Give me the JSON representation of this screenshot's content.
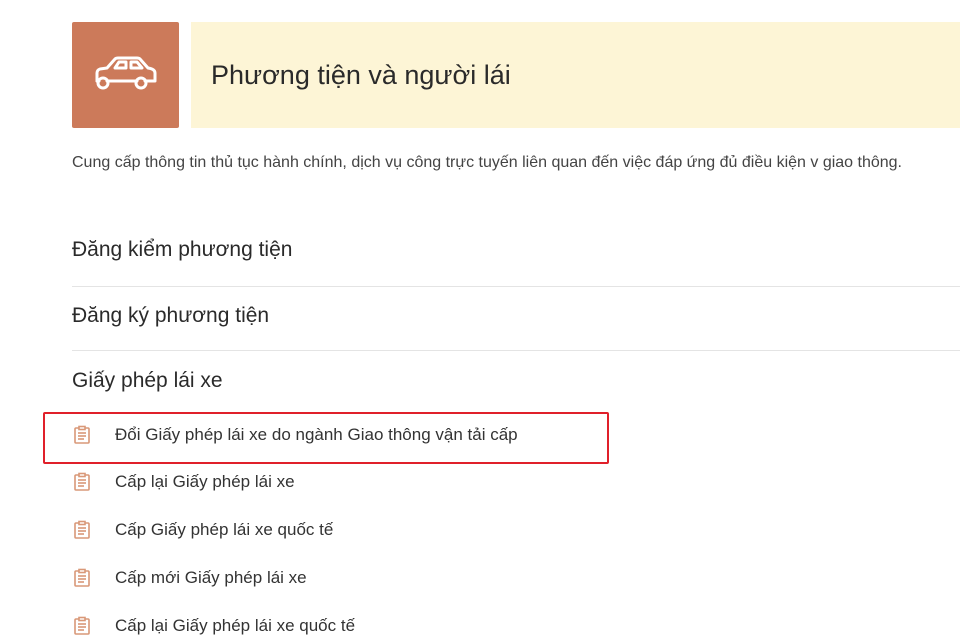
{
  "header": {
    "icon": "car-icon",
    "title": "Phương tiện và người lái",
    "icon_bg_color": "#cc7a5a",
    "title_bg_color": "#fdf5d6"
  },
  "description": "Cung cấp thông tin thủ tục hành chính, dịch vụ công trực tuyến liên quan đến việc đáp ứng đủ điều kiện v giao thông.",
  "sections": [
    {
      "label": "Đăng kiểm phương tiện"
    },
    {
      "label": "Đăng ký phương tiện"
    },
    {
      "label": "Giấy phép lái xe"
    }
  ],
  "items": [
    {
      "label": "Đổi Giấy phép lái xe do ngành Giao thông vận tải cấp",
      "icon": "document-icon",
      "highlighted": true
    },
    {
      "label": "Cấp lại Giấy phép lái xe",
      "icon": "document-icon"
    },
    {
      "label": "Cấp Giấy phép lái xe quốc tế",
      "icon": "document-icon"
    },
    {
      "label": "Cấp mới Giấy phép lái xe",
      "icon": "document-icon"
    },
    {
      "label": "Cấp lại Giấy phép lái xe quốc tế",
      "icon": "document-icon"
    }
  ],
  "highlight_color": "#e0202a"
}
